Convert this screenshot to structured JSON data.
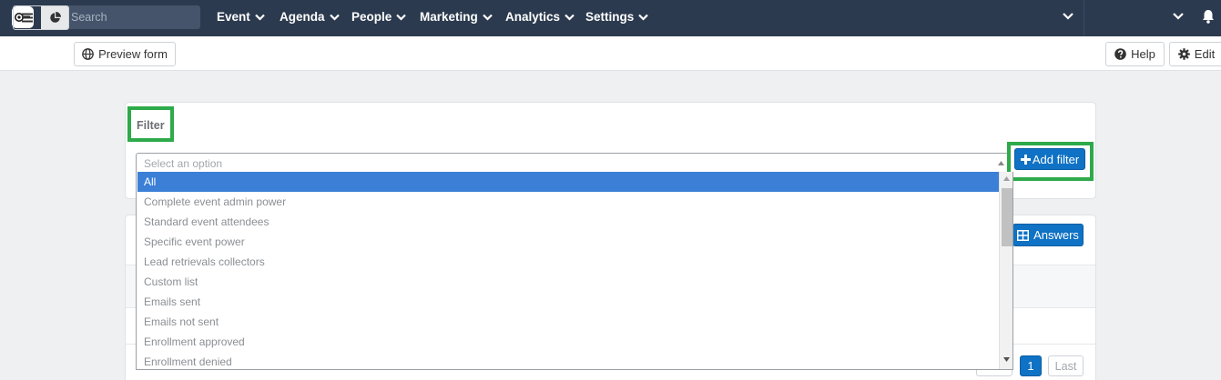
{
  "navbar": {
    "search_placeholder": "Search",
    "items": [
      {
        "label": "Event"
      },
      {
        "label": "Agenda"
      },
      {
        "label": "People"
      },
      {
        "label": "Marketing"
      },
      {
        "label": "Analytics"
      },
      {
        "label": "Settings"
      }
    ]
  },
  "toolbar": {
    "preview_label": "Preview form",
    "help_label": "Help",
    "edit_label": "Edit"
  },
  "filter": {
    "title": "Filter",
    "select_placeholder": "Select an option",
    "add_filter_label": "Add filter",
    "options": [
      {
        "label": "All",
        "selected": true
      },
      {
        "label": "Complete event admin power"
      },
      {
        "label": "Standard event attendees"
      },
      {
        "label": "Specific event power"
      },
      {
        "label": "Lead retrievals collectors"
      },
      {
        "label": "Custom list"
      },
      {
        "label": "Emails sent"
      },
      {
        "label": "Emails not sent"
      },
      {
        "label": "Enrollment approved"
      },
      {
        "label": "Enrollment denied"
      }
    ]
  },
  "answers": {
    "answers_label": "Answers",
    "pagination": {
      "current_page": "1",
      "last_label": "Last"
    }
  },
  "colors": {
    "navbar_bg": "#2c3a4f",
    "primary": "#0f72c4",
    "selected_option": "#3b7fd6",
    "highlight": "#2eaa4a"
  }
}
